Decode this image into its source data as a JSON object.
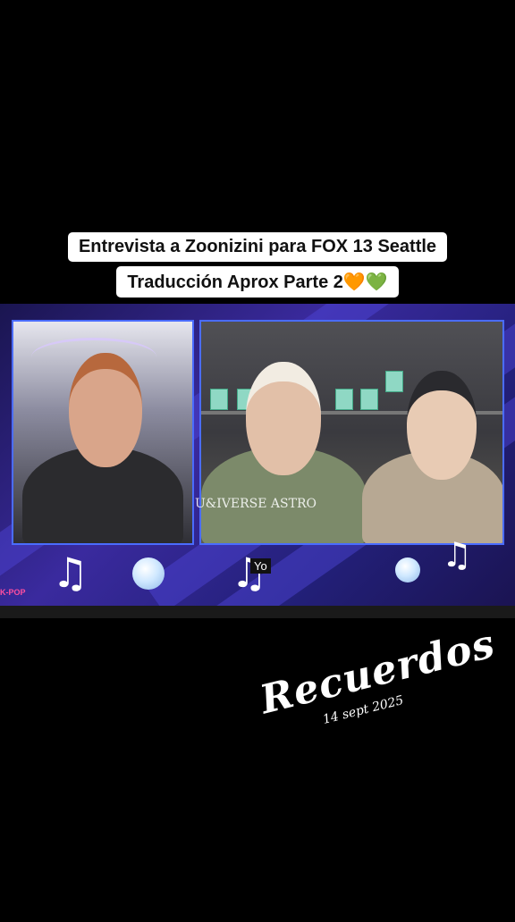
{
  "caption": {
    "line1": "Entrevista  a Zoonizini para FOX 13 Seattle",
    "line2": "Traducción Aprox Parte 2🧡💚"
  },
  "video": {
    "watermark": "U&IVERSE ASTRO",
    "tag": "Yo",
    "logo": "K-POP"
  },
  "overlay": {
    "title": "Recuerdos",
    "date": "14 sept 2025"
  },
  "icons": [
    "music-note-icon",
    "orb-icon"
  ]
}
